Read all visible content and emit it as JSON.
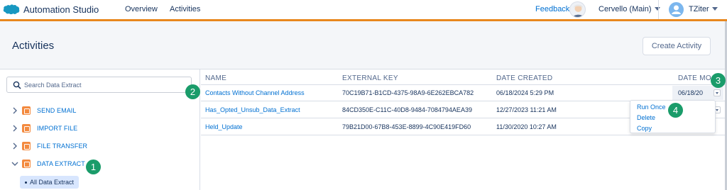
{
  "topbar": {
    "app_title": "Automation Studio",
    "nav": [
      "Overview",
      "Activities"
    ],
    "feedback": "Feedback",
    "org_name": "Cervello (Main)",
    "user_name": "TZiter",
    "accent_color": "#e8871e"
  },
  "header": {
    "title": "Activities",
    "create_button": "Create Activity"
  },
  "sidebar": {
    "search_placeholder": "Search Data Extract",
    "items": [
      {
        "label": "SEND EMAIL",
        "icon": "email-icon",
        "expanded": false
      },
      {
        "label": "IMPORT FILE",
        "icon": "import-icon",
        "expanded": false
      },
      {
        "label": "FILE TRANSFER",
        "icon": "file-transfer-icon",
        "expanded": false
      },
      {
        "label": "DATA EXTRACT",
        "icon": "data-extract-icon",
        "expanded": true
      }
    ],
    "selected_sub": "All Data Extract"
  },
  "table": {
    "columns": [
      "NAME",
      "EXTERNAL KEY",
      "DATE CREATED",
      "DATE MO"
    ],
    "rows": [
      {
        "name": "Contacts Without Channel Address",
        "key": "70C19B71-B1CD-4375-98A9-6E262EBCA782",
        "created": "06/18/2024 5:29 PM",
        "modified": "06/18/20"
      },
      {
        "name": "Has_Opted_Unsub_Data_Extract",
        "key": "84CD350E-C11C-40D8-9484-7084794AEA39",
        "created": "12/27/2023 11:21 AM",
        "modified": ""
      },
      {
        "name": "Held_Update",
        "key": "79B21D00-67B8-453E-8899-4C90E419FD60",
        "created": "11/30/2020 10:27 AM",
        "modified": ""
      }
    ]
  },
  "dropdown": [
    "Run Once",
    "Delete",
    "Copy"
  ],
  "callouts": [
    "1",
    "2",
    "3",
    "4"
  ]
}
